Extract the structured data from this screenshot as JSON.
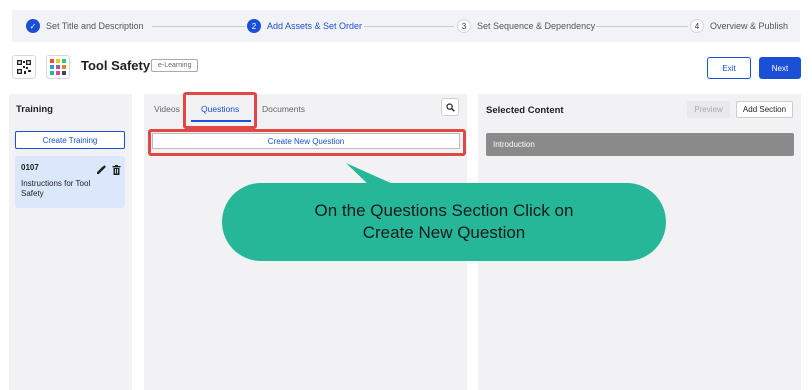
{
  "stepper": {
    "steps": [
      {
        "number": "✓",
        "label": "Set Title and Description",
        "state": "done"
      },
      {
        "number": "2",
        "label": "Add Assets & Set Order",
        "state": "active"
      },
      {
        "number": "3",
        "label": "Set Sequence & Dependency",
        "state": "todo"
      },
      {
        "number": "4",
        "label": "Overview & Publish",
        "state": "todo"
      }
    ]
  },
  "header": {
    "title": "Tool Safety",
    "tag": "e-Learning",
    "exit_label": "Exit",
    "next_label": "Next"
  },
  "training_panel": {
    "title": "Training",
    "create_label": "Create Training",
    "item": {
      "code": "0107",
      "name": "Instructions for Tool Safety"
    }
  },
  "assets_panel": {
    "tabs": [
      {
        "label": "Videos"
      },
      {
        "label": "Questions",
        "active": true
      },
      {
        "label": "Documents"
      }
    ],
    "create_question_label": "Create New Question"
  },
  "selected_panel": {
    "title": "Selected Content",
    "preview_label": "Preview",
    "add_section_label": "Add Section",
    "sections": [
      {
        "label": "Introduction"
      }
    ]
  },
  "callout": {
    "line1": "On the Questions Section Click on",
    "line2": "Create New Question"
  },
  "colors": {
    "accent": "#1a4fd6",
    "highlight": "#e04848",
    "callout": "#26b799",
    "panel_bg": "#f2f2f4",
    "card_bg": "#dbe8fb"
  }
}
